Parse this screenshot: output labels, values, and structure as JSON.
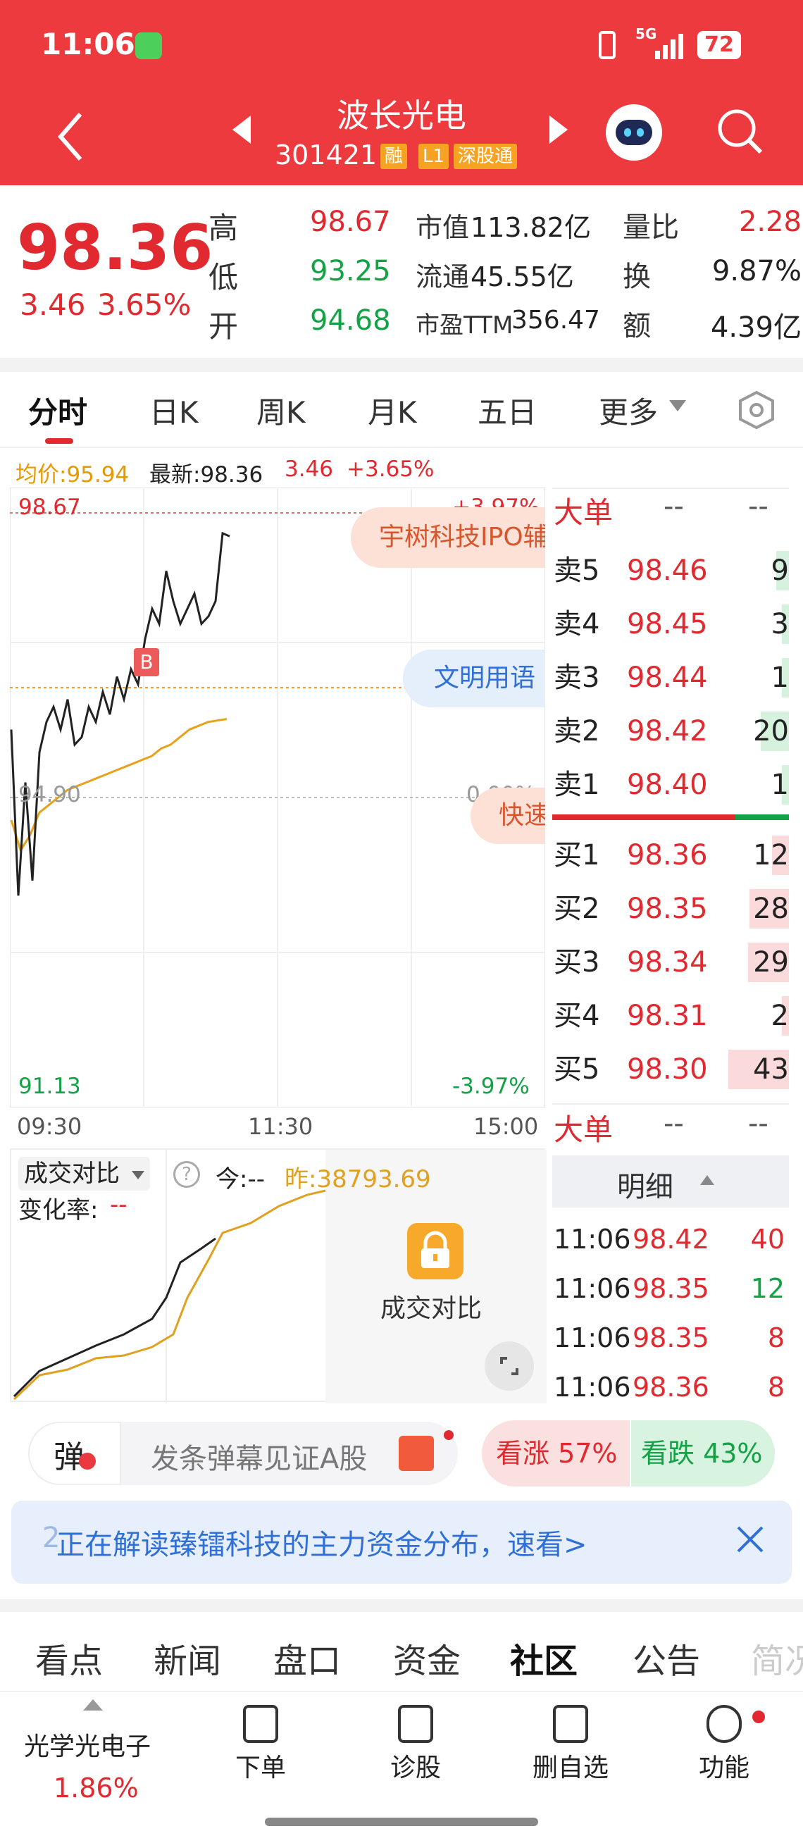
{
  "status_bar": {
    "time": "11:06",
    "battery": "72",
    "network": "5G"
  },
  "header": {
    "title": "波长光电",
    "code": "301421",
    "tags": [
      "融",
      "L1",
      "深股通"
    ]
  },
  "quote": {
    "price": "98.36",
    "change": "3.46",
    "change_pct": "3.65%",
    "labels": {
      "high": "高",
      "low": "低",
      "open": "开",
      "mkt_cap": "市值",
      "float": "流通",
      "pe": "市盈TTM",
      "vol_ratio": "量比",
      "turnover": "换",
      "amount": "额"
    },
    "high": "98.67",
    "low": "93.25",
    "open": "94.68",
    "mkt_cap": "113.82亿",
    "float": "45.55亿",
    "pe": "356.47",
    "vol_ratio": "2.28",
    "turnover": "9.87%",
    "amount": "4.39亿"
  },
  "tabs": [
    "分时",
    "日K",
    "周K",
    "月K",
    "五日",
    "更多"
  ],
  "chart_info": {
    "avg_label": "均价:95.94",
    "latest_label": "最新:98.36",
    "latest_change": "3.46",
    "latest_pct": "+3.65%"
  },
  "chart_data": {
    "type": "line",
    "x_ticks": [
      "09:30",
      "11:30",
      "15:00"
    ],
    "y_top": "98.67",
    "y_mid": "94.90",
    "y_bottom": "91.13",
    "pct_top": "+3.97%",
    "pct_mid": "0.00%",
    "pct_bottom": "-3.97%",
    "ylim": [
      91.13,
      98.67
    ],
    "marker": "B",
    "series": [
      {
        "values": [
          95.8,
          93.6,
          95.1,
          93.8,
          95.5,
          95.9,
          96.1,
          95.8,
          96.2,
          95.6,
          95.7,
          96.1,
          95.9,
          96.3,
          96.0,
          96.5,
          96.2,
          96.6,
          96.4,
          97.0,
          97.4,
          97.2,
          97.9,
          97.5,
          97.2,
          97.4,
          97.6,
          97.2,
          97.3,
          97.5,
          98.4,
          98.36
        ]
      },
      {
        "values": [
          94.6,
          94.2,
          94.4,
          94.7,
          94.8,
          94.9,
          95.0,
          95.05,
          95.1,
          95.15,
          95.2,
          95.25,
          95.3,
          95.35,
          95.4,
          95.45,
          95.55,
          95.6,
          95.7,
          95.8,
          95.85,
          95.9,
          95.92,
          95.94
        ]
      }
    ]
  },
  "order_book": {
    "big_order_label": "大单",
    "big_order_values": [
      "--",
      "--"
    ],
    "asks": [
      {
        "label": "卖5",
        "price": "98.46",
        "vol": "9"
      },
      {
        "label": "卖4",
        "price": "98.45",
        "vol": "3"
      },
      {
        "label": "卖3",
        "price": "98.44",
        "vol": "1"
      },
      {
        "label": "卖2",
        "price": "98.42",
        "vol": "20"
      },
      {
        "label": "卖1",
        "price": "98.40",
        "vol": "1"
      }
    ],
    "bids": [
      {
        "label": "买1",
        "price": "98.36",
        "vol": "12"
      },
      {
        "label": "买2",
        "price": "98.35",
        "vol": "28"
      },
      {
        "label": "买3",
        "price": "98.34",
        "vol": "29"
      },
      {
        "label": "买4",
        "price": "98.31",
        "vol": "2"
      },
      {
        "label": "买5",
        "price": "98.30",
        "vol": "43"
      }
    ]
  },
  "detail": {
    "big_order_label": "大单",
    "big_order_values": [
      "--",
      "--"
    ],
    "title": "明细",
    "rows": [
      {
        "time": "11:06",
        "price": "98.42",
        "vol": "40"
      },
      {
        "time": "11:06",
        "price": "98.35",
        "vol": "12"
      },
      {
        "time": "11:06",
        "price": "98.35",
        "vol": "8"
      },
      {
        "time": "11:06",
        "price": "98.36",
        "vol": "8"
      }
    ]
  },
  "overlay_tags": [
    "宇树科技IPO辅",
    "文明用语",
    "快速"
  ],
  "compare": {
    "title": "成交对比",
    "today": "今:--",
    "yesterday": "昨:38793.69",
    "change_rate_label": "变化率:",
    "change_rate_value": "--",
    "lock_label": "成交对比"
  },
  "danmu": {
    "badge": "弹",
    "placeholder": "发条弹幕见证A股",
    "up": "看涨 57%",
    "down": "看跌 43%"
  },
  "banner": {
    "text": "正在解读臻镭科技的主力资金分布，速看>",
    "prefix": "2"
  },
  "bottom_tabs": [
    "看点",
    "新闻",
    "盘口",
    "资金",
    "社区",
    "公告",
    "简况"
  ],
  "bottom_bar": {
    "sector_name": "光学光电子",
    "sector_pct": "1.86%",
    "items": [
      "下单",
      "诊股",
      "删自选",
      "功能"
    ]
  }
}
